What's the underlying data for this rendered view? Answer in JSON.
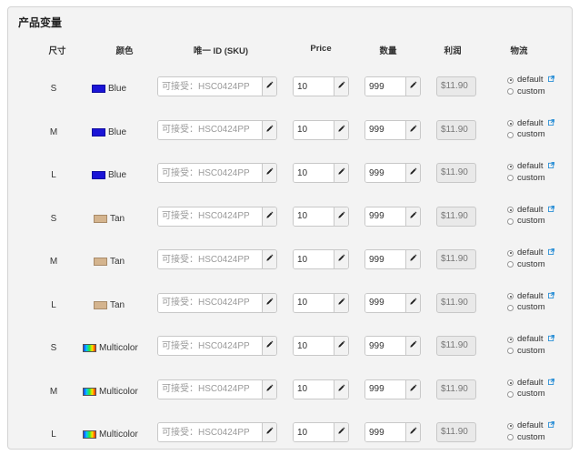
{
  "panel": {
    "title": "产品变量"
  },
  "headers": {
    "size": "尺寸",
    "color": "颜色",
    "sku": "唯一 ID (SKU)",
    "price": "Price",
    "qty": "数量",
    "profit": "利润",
    "shipping": "物流"
  },
  "colors": {
    "Blue": {
      "swatch": "#1a14d6",
      "border": "#0f0b9e"
    },
    "Tan": {
      "swatch": "#d4b48e",
      "border": "#a88a68"
    },
    "Multicolor": {
      "swatch": "gradient",
      "border": "#555555"
    }
  },
  "rows": [
    {
      "size": "S",
      "color": "Blue",
      "sku_placeholder": "可接受：HSC0424PP",
      "price": "10",
      "qty": "999",
      "profit": "$11.90",
      "ship_default": "default",
      "ship_custom": "custom",
      "selected": "default"
    },
    {
      "size": "M",
      "color": "Blue",
      "sku_placeholder": "可接受：HSC0424PP",
      "price": "10",
      "qty": "999",
      "profit": "$11.90",
      "ship_default": "default",
      "ship_custom": "custom",
      "selected": "default"
    },
    {
      "size": "L",
      "color": "Blue",
      "sku_placeholder": "可接受：HSC0424PP",
      "price": "10",
      "qty": "999",
      "profit": "$11.90",
      "ship_default": "default",
      "ship_custom": "custom",
      "selected": "default"
    },
    {
      "size": "S",
      "color": "Tan",
      "sku_placeholder": "可接受：HSC0424PP",
      "price": "10",
      "qty": "999",
      "profit": "$11.90",
      "ship_default": "default",
      "ship_custom": "custom",
      "selected": "default"
    },
    {
      "size": "M",
      "color": "Tan",
      "sku_placeholder": "可接受：HSC0424PP",
      "price": "10",
      "qty": "999",
      "profit": "$11.90",
      "ship_default": "default",
      "ship_custom": "custom",
      "selected": "default"
    },
    {
      "size": "L",
      "color": "Tan",
      "sku_placeholder": "可接受：HSC0424PP",
      "price": "10",
      "qty": "999",
      "profit": "$11.90",
      "ship_default": "default",
      "ship_custom": "custom",
      "selected": "default"
    },
    {
      "size": "S",
      "color": "Multicolor",
      "sku_placeholder": "可接受：HSC0424PP",
      "price": "10",
      "qty": "999",
      "profit": "$11.90",
      "ship_default": "default",
      "ship_custom": "custom",
      "selected": "default"
    },
    {
      "size": "M",
      "color": "Multicolor",
      "sku_placeholder": "可接受：HSC0424PP",
      "price": "10",
      "qty": "999",
      "profit": "$11.90",
      "ship_default": "default",
      "ship_custom": "custom",
      "selected": "default"
    },
    {
      "size": "L",
      "color": "Multicolor",
      "sku_placeholder": "可接受：HSC0424PP",
      "price": "10",
      "qty": "999",
      "profit": "$11.90",
      "ship_default": "default",
      "ship_custom": "custom",
      "selected": "default"
    }
  ],
  "icons": {
    "edit": "pencil-icon",
    "external": "external-link-icon"
  },
  "accent": "#2a8fd6"
}
